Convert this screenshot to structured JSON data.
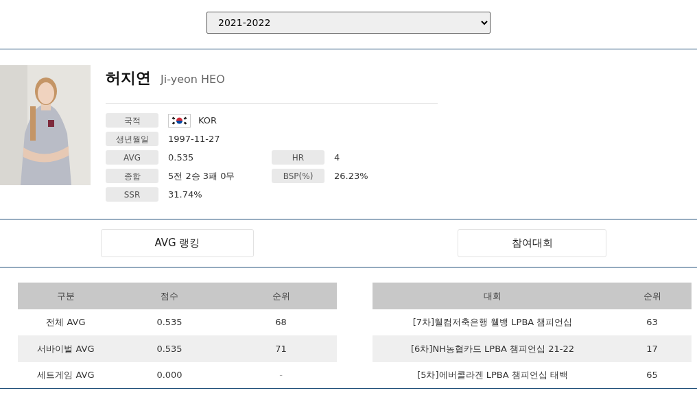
{
  "season_select": {
    "value": "2021-2022"
  },
  "player": {
    "name_ko": "허지연",
    "name_en": "Ji-yeon HEO",
    "photo": {
      "kind": "picture"
    },
    "info_rows": [
      [
        {
          "label": "국적",
          "value": "KOR",
          "flag": true
        }
      ],
      [
        {
          "label": "생년월일",
          "value": "1997-11-27"
        }
      ],
      [
        {
          "label": "AVG",
          "value": "0.535"
        },
        {
          "label": "HR",
          "value": "4"
        }
      ],
      [
        {
          "label": "종합",
          "value": "5전 2승 3패 0무"
        },
        {
          "label": "BSP(%)",
          "value": "26.23%"
        }
      ],
      [
        {
          "label": "SSR",
          "value": "31.74%"
        }
      ]
    ]
  },
  "buttons": [
    "AVG 랭킹",
    "참여대회"
  ],
  "ranking_table": {
    "columns": [
      "구분",
      "점수",
      "순위"
    ],
    "rows": [
      [
        "전체 AVG",
        "0.535",
        "68"
      ],
      [
        "서바이벌 AVG",
        "0.535",
        "71"
      ],
      [
        "세트게임 AVG",
        "0.000",
        "-"
      ]
    ]
  },
  "tournament_table": {
    "columns": [
      "대회",
      "순위"
    ],
    "rows": [
      [
        "[7차]웰컴저축은행 웰뱅 LPBA 챔피언십",
        "63"
      ],
      [
        "[6차]NH농협카드 LPBA 챔피언십 21-22",
        "17"
      ],
      [
        "[5차]에버콜라겐 LPBA 챔피언십 태백",
        "65"
      ]
    ]
  }
}
